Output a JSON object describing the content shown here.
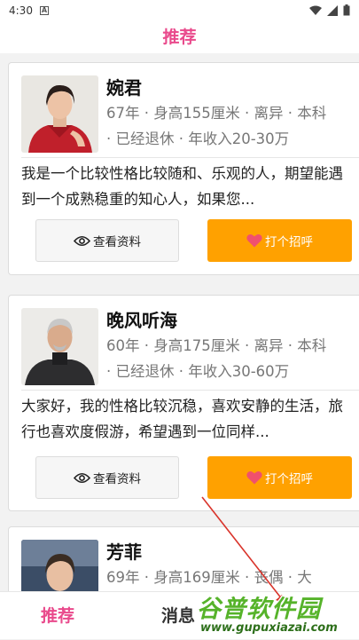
{
  "status_bar": {
    "time": "4:30"
  },
  "header": {
    "title": "推荐"
  },
  "profiles": [
    {
      "name": "婉君",
      "meta": "67年 · 身高155厘米 · 离异 · 本科 · 已经退休 · 年收入20-30万",
      "bio": "我是一个比较性格比较随和、乐观的人，期望能遇到一个成熟稳重的知心人，如果您..."
    },
    {
      "name": "晚风听海",
      "meta": "60年 · 身高175厘米 · 离异 · 本科 · 已经退休 · 年收入30-60万",
      "bio": "大家好，我的性格比较沉稳，喜欢安静的生活，旅行也喜欢度假游，希望遇到一位同样..."
    },
    {
      "name": "芳菲",
      "meta": "69年 · 身高169厘米 · 丧偶 · 大"
    }
  ],
  "buttons": {
    "view_profile": "查看资料",
    "say_hi": "打个招呼"
  },
  "tabbar": {
    "recommend": "推荐",
    "messages": "消息"
  },
  "watermark": {
    "title": "谷普软件园",
    "url": "www.gupuxiazai.com"
  },
  "colors": {
    "accent_pink": "#e94a8c",
    "button_orange": "#ffa100",
    "heart_red": "#f0506e"
  }
}
